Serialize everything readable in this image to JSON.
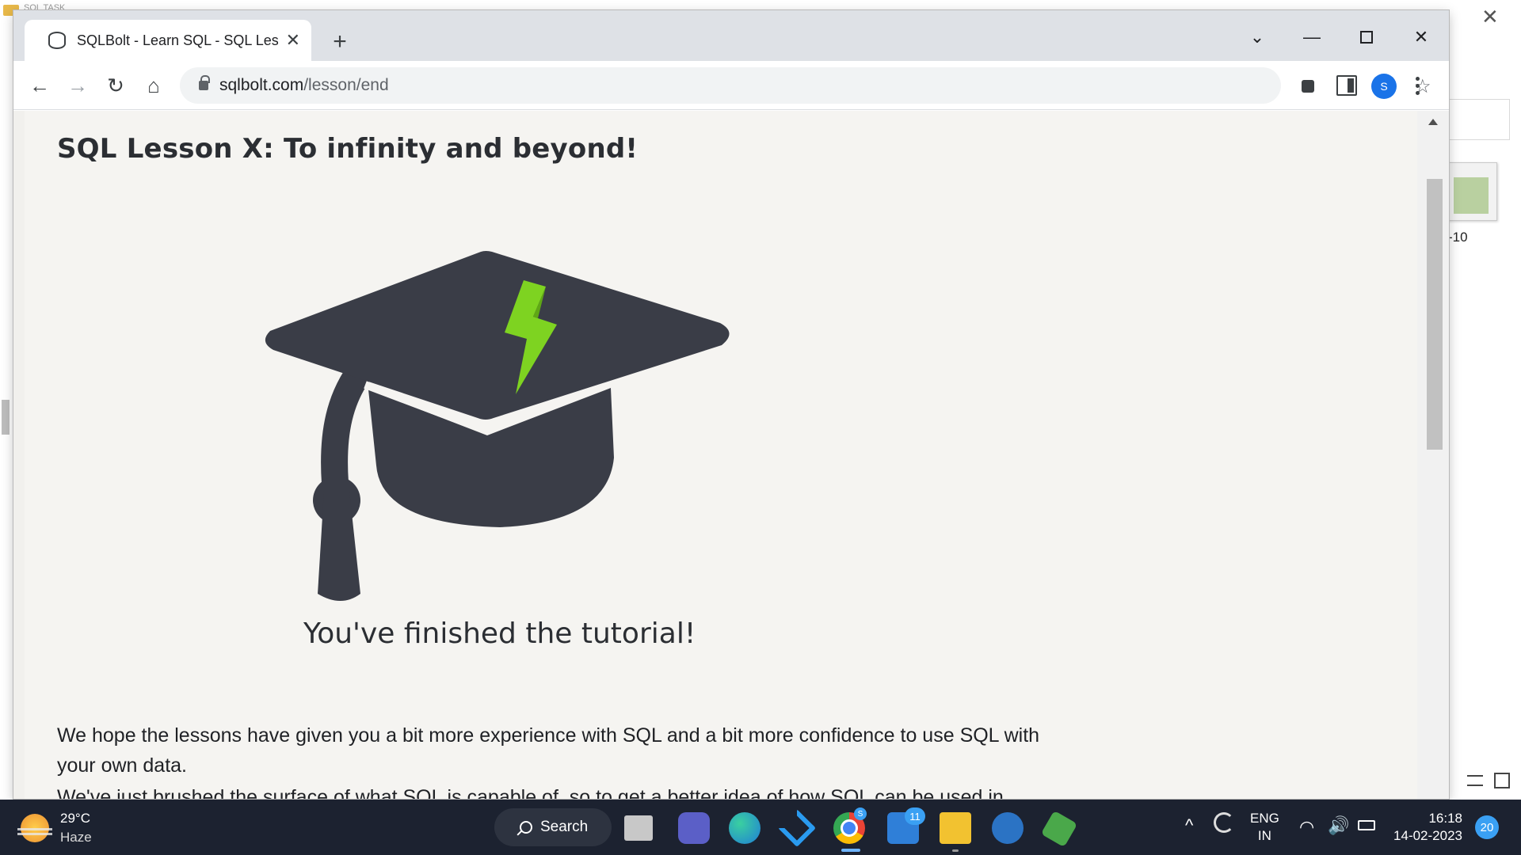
{
  "background_window": {
    "folder_title": "SQL TASK",
    "thumbnail_label": "-10"
  },
  "browser": {
    "tab": {
      "title": "SQLBolt - Learn SQL - SQL Lesson X: To infinity and beyond!",
      "close_glyph": "✕"
    },
    "new_tab_glyph": "+",
    "window_controls": {
      "tab_search_glyph": "⌄",
      "minimize_glyph": "—",
      "close_glyph": "✕"
    },
    "nav": {
      "back_glyph": "←",
      "forward_glyph": "→",
      "reload_glyph": "↻",
      "home_glyph": "⌂"
    },
    "url": {
      "host": "sqlbolt.com",
      "path": "/lesson/end"
    },
    "share_glyph": "⇪",
    "bookmark_glyph": "☆",
    "profile_initial": "S",
    "colors": {
      "tabstrip": "#dee1e6",
      "profile": "#1a73e8"
    }
  },
  "page": {
    "lesson_title": "SQL Lesson X: To infinity and beyond!",
    "finished_caption": "You've finished the tutorial!",
    "paragraph_1": "We hope the lessons have given you a bit more experience with SQL and a bit more confidence to use SQL with your own data.",
    "paragraph_2": "We've just brushed the surface of what SQL is capable of, so to get a better idea of how SQL can be used in",
    "colors": {
      "cap": "#3a3d47",
      "bolt": "#7ed321",
      "page_bg": "#f5f4f1"
    }
  },
  "taskbar": {
    "weather": {
      "temperature": "29°C",
      "condition": "Haze"
    },
    "search_label": "Search",
    "mail_badge": "11",
    "chrome_badge": "S",
    "language": {
      "line1": "ENG",
      "line2": "IN"
    },
    "clock": {
      "time": "16:18",
      "date": "14-02-2023"
    },
    "notifications": "20",
    "tray_caret_glyph": "^",
    "wifi_glyph": "◠",
    "volume_glyph": "🔊"
  }
}
